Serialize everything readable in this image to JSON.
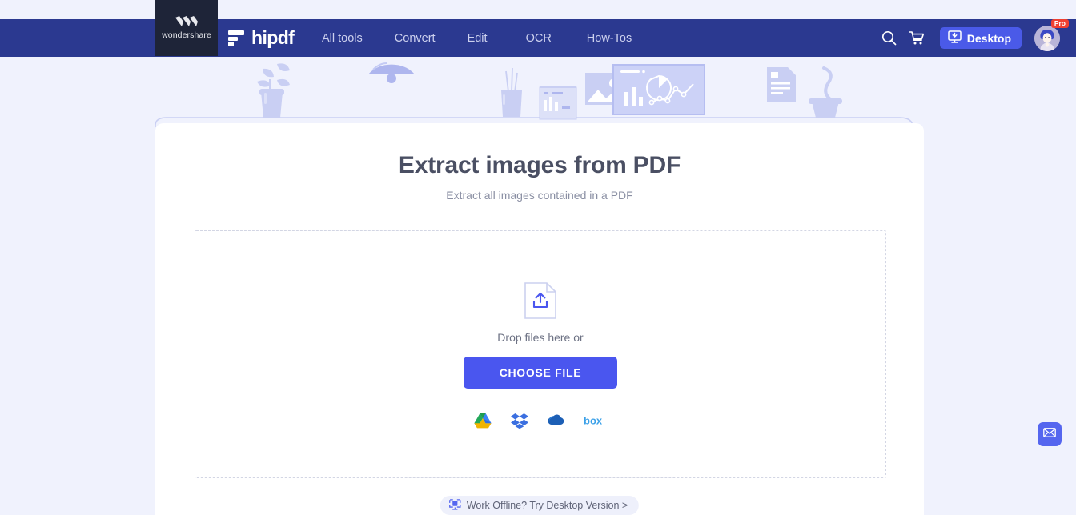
{
  "brand": {
    "wondershare_label": "wondershare",
    "wondershare_icon": "wondershare-w-logo-icon",
    "hipdf_label": "hipdf",
    "hipdf_mark_icon": "hipdf-logo-mark-icon"
  },
  "nav": {
    "links": [
      {
        "label": "All tools"
      },
      {
        "label": "Convert"
      },
      {
        "label": "Edit"
      },
      {
        "label": "OCR"
      },
      {
        "label": "How-Tos"
      }
    ],
    "search_icon": "search-icon",
    "cart_icon": "shopping-cart-icon",
    "desktop_button": {
      "label": "Desktop",
      "icon": "monitor-download-icon"
    },
    "account": {
      "avatar_icon": "user-avatar-icon",
      "badge": "Pro"
    }
  },
  "main": {
    "title": "Extract images from PDF",
    "subtitle": "Extract all images contained in a PDF",
    "dropzone": {
      "upload_icon": "file-upload-icon",
      "drop_text": "Drop files here or",
      "choose_button": "CHOOSE FILE",
      "cloud_sources": [
        {
          "name": "google-drive-icon",
          "label": "Google Drive"
        },
        {
          "name": "dropbox-icon",
          "label": "Dropbox"
        },
        {
          "name": "onedrive-icon",
          "label": "OneDrive"
        },
        {
          "name": "box-icon",
          "label": "Box"
        }
      ]
    },
    "offline_button": {
      "label": "Work Offline? Try Desktop Version >",
      "icon": "monitor-download-icon"
    }
  },
  "widgets": {
    "mail_fab_icon": "envelope-icon"
  },
  "colors": {
    "page_background": "#f0f2fd",
    "navbar": "#2b3990",
    "wondershare_block": "#1e2438",
    "primary_button": "#4a56ef",
    "desktop_button": "#4a5ae8",
    "pro_badge": "#ef4030",
    "title_text": "#4a4f63",
    "subtitle_text": "#8a8fa3",
    "dropzone_border": "#d3d6e4",
    "decor_illustration": "#c9cff3"
  },
  "decor": {
    "items": [
      "potted-plant-icon",
      "pendant-lamp-icon",
      "pencil-cup-icon",
      "small-dashboard-card-icon",
      "photo-card-icon",
      "monitor-analytics-icon",
      "document-icon",
      "coffee-cup-icon"
    ]
  }
}
